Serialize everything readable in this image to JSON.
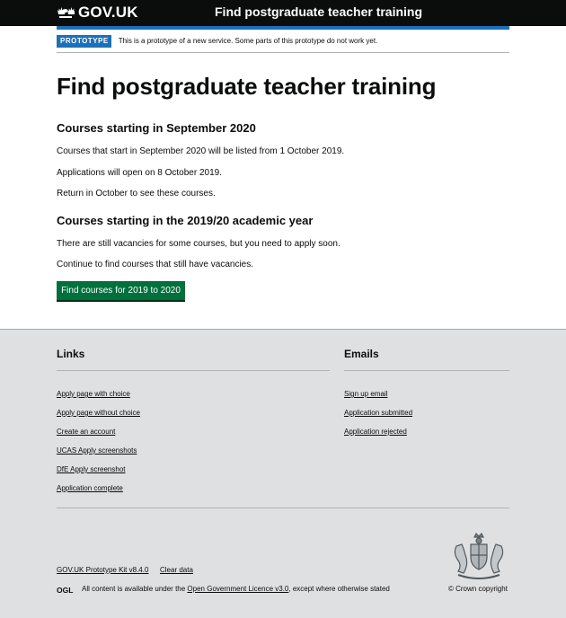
{
  "header": {
    "logo_text": "GOV.UK",
    "service_name": "Find postgraduate teacher training"
  },
  "phase_banner": {
    "tag": "PROTOTYPE",
    "text": "This is a prototype of a new service. Some parts of this prototype do not work yet."
  },
  "main": {
    "title": "Find postgraduate teacher training",
    "section1": {
      "heading": "Courses starting in September 2020",
      "paragraphs": [
        "Courses that start in September 2020 will be listed from 1 October 2019.",
        "Applications will open on 8 October 2019.",
        "Return in October to see these courses."
      ]
    },
    "section2": {
      "heading": "Courses starting in the 2019/20 academic year",
      "paragraphs": [
        "There are still vacancies for some courses, but you need to apply soon.",
        "Continue to find courses that still have vacancies."
      ],
      "button_label": "Find courses for 2019 to 2020"
    }
  },
  "footer": {
    "links_heading": "Links",
    "links": [
      "Apply page with choice",
      "Apply page without choice",
      "Create an account",
      "UCAS Apply screenshots",
      "DfE Apply screenshot",
      "Application complete"
    ],
    "emails_heading": "Emails",
    "emails": [
      "Sign up email",
      "Application submitted",
      "Application rejected"
    ],
    "meta_links": [
      "GOV.UK Prototype Kit v8.4.0",
      "Clear data"
    ],
    "licence_prefix": "All content is available under the",
    "licence_link": "Open Government Licence v3.0",
    "licence_suffix": ", except where otherwise stated",
    "copyright": "© Crown copyright"
  },
  "colors": {
    "header_bg": "#0b0c0c",
    "brand_blue": "#1d70b8",
    "button_green": "#00703c",
    "footer_bg": "#dee0e2"
  }
}
